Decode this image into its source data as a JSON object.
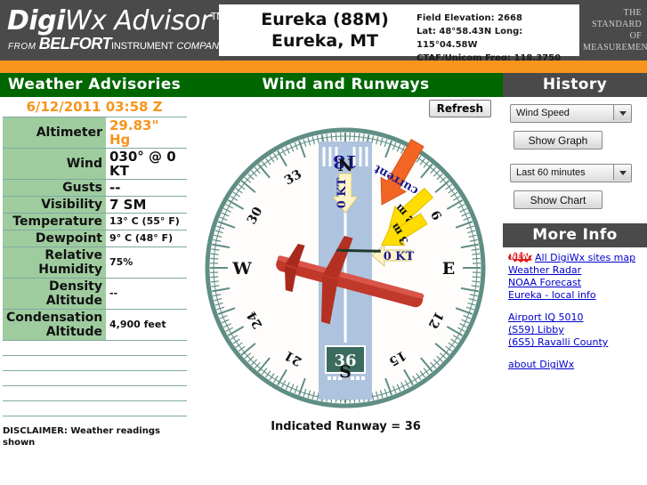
{
  "brand": {
    "line1_bold": "Digi",
    "line1_rest": "Wx Advisor",
    "trademark": "TM",
    "from": "FROM",
    "belfort": "BELFORT",
    "instrument": "INSTRUMENT",
    "company": "COMPANY",
    "standard": "THE STANDARD OF MEASUREMENT"
  },
  "station": {
    "name": "Eureka (88M)",
    "location": "Eureka, MT",
    "field_elevation": "Field Elevation: 2668",
    "latlong": "Lat: 48°58.43N  Long: 115°04.58W",
    "ctaf": "CTAF/Unicom Freq: 118.3750"
  },
  "weather": {
    "header": "Weather Advisories",
    "timestamp": "6/12/2011 03:58 Z",
    "rows": [
      {
        "label": "Altimeter",
        "value": "29.83\" Hg",
        "style": "orange"
      },
      {
        "label": "Wind",
        "value": "030° @ 0 KT",
        "style": "big"
      },
      {
        "label": "Gusts",
        "value": "--",
        "style": "big"
      },
      {
        "label": "Visibility",
        "value": "7 SM",
        "style": "big"
      },
      {
        "label": "Temperature",
        "value": "13° C (55° F)",
        "style": "small"
      },
      {
        "label": "Dewpoint",
        "value": "9° C (48° F)",
        "style": "small"
      },
      {
        "label": "Relative Humidity",
        "value": "75%",
        "style": "small"
      },
      {
        "label": "Density Altitude",
        "value": "--",
        "style": "small"
      },
      {
        "label": "Condensation Altitude",
        "value": "4,900 feet",
        "style": "small"
      }
    ],
    "disclaimer": "DISCLAIMER: Weather readings shown"
  },
  "wind_runways": {
    "header": "Wind and Runways",
    "refresh_label": "Refresh",
    "caption": "Indicated Runway = 36",
    "runway_top_label": "18",
    "runway_bottom_label": "36",
    "wind_arrow_label": "0 KT",
    "crosswind_label": "0 KT",
    "current_label": "current",
    "gust_labels": [
      "2 m",
      "3 m"
    ],
    "cardinals": [
      "N",
      "E",
      "S",
      "W"
    ],
    "tick_labels": [
      "3",
      "6",
      "12",
      "15",
      "21",
      "24",
      "30",
      "33"
    ],
    "colors": {
      "dial_ring": "#5f8e85",
      "runway_strip": "#aec3de",
      "airplane": "#c0392b",
      "current_arrow": "#f26522",
      "gust_arrow": "#ffdd00",
      "sign_green": "#3b6b5e"
    }
  },
  "history": {
    "header": "History",
    "metric_selected": "Wind Speed",
    "graph_button": "Show Graph",
    "range_selected": "Last 60 minutes",
    "chart_button": "Show Chart"
  },
  "more_info": {
    "header": "More Info",
    "new_badge": "NEW",
    "links_group1": [
      "All DigiWx sites map",
      "Weather Radar",
      "NOAA Forecast",
      "Eureka - local info"
    ],
    "links_group2": [
      "Airport IQ 5010",
      "(S59) Libby",
      "(6S5) Ravalli County"
    ],
    "links_group3": [
      "about DigiWx"
    ]
  }
}
